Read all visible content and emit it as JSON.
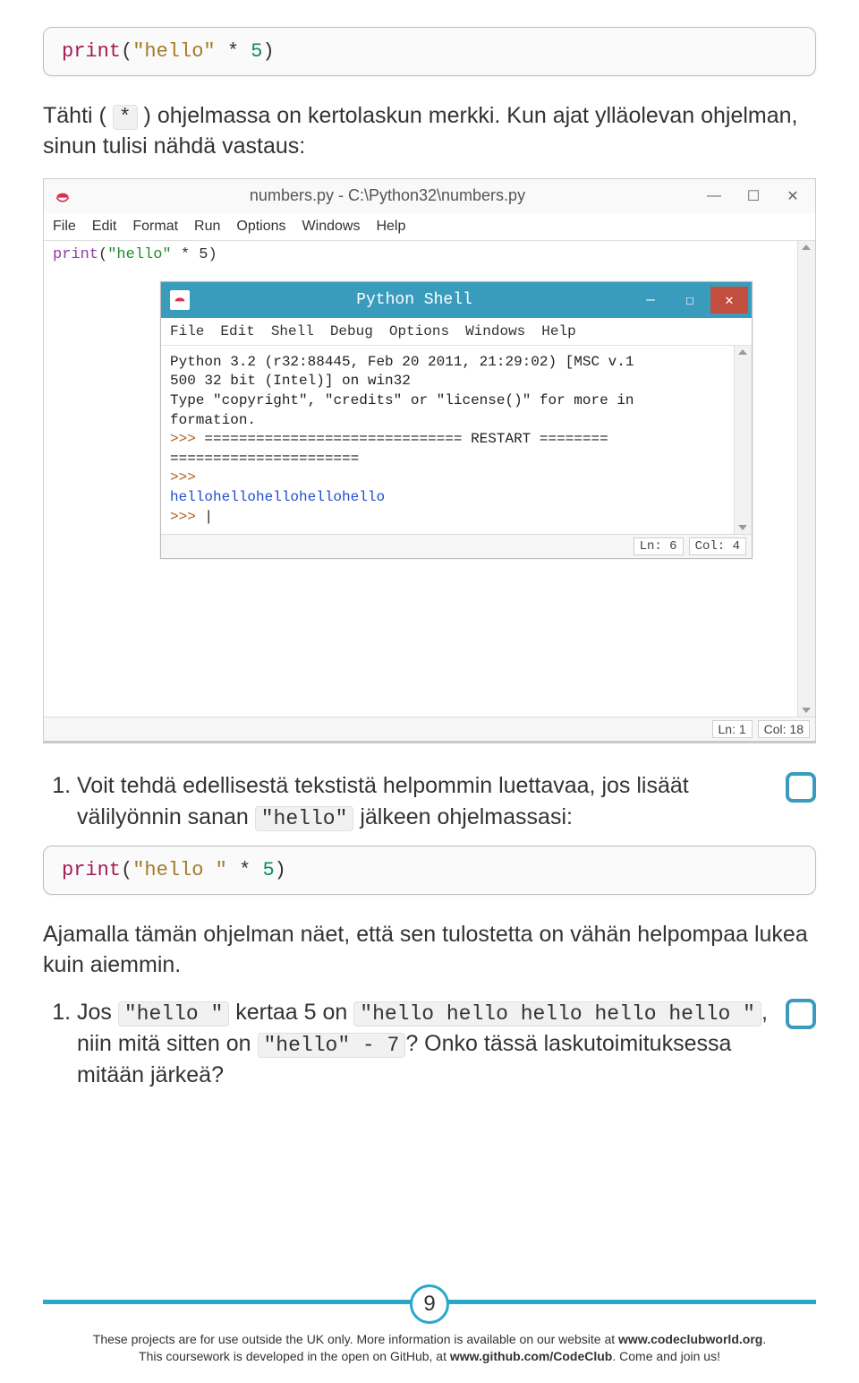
{
  "codeblock1": {
    "print": "print",
    "open": "(",
    "str": "\"hello\"",
    "sp": " * ",
    "num": "5",
    "close": ")"
  },
  "para1": {
    "text_a": "Tähti ( ",
    "inline": "*",
    "text_b": " ) ohjelmassa on kertolaskun merkki. Kun ajat ylläolevan ohjelman, sinun tulisi nähdä vastaus:"
  },
  "ide": {
    "title": "numbers.py - C:\\Python32\\numbers.py",
    "minimize": "—",
    "maximize": "☐",
    "close": "✕",
    "menus": [
      "File",
      "Edit",
      "Format",
      "Run",
      "Options",
      "Windows",
      "Help"
    ],
    "editor_line": {
      "kw": "print",
      "open": "(",
      "str": "\"hello\"",
      "op": " * 5",
      "close": ")"
    },
    "status": {
      "ln": "Ln: 1",
      "col": "Col: 18"
    }
  },
  "shell": {
    "title": "Python Shell",
    "minimize": "—",
    "maximize": "☐",
    "close": "✕",
    "menus": [
      "File",
      "Edit",
      "Shell",
      "Debug",
      "Options",
      "Windows",
      "Help"
    ],
    "line1": "Python 3.2 (r32:88445, Feb 20 2011, 21:29:02) [MSC v.1",
    "line2": "500 32 bit (Intel)] on win32",
    "line3a": "Type ",
    "line3b": "\"copyright\"",
    "line3c": ", ",
    "line3d": "\"credits\"",
    "line3e": " or ",
    "line3f": "\"license()\"",
    "line3g": " for more in",
    "line4": "formation.",
    "prompt": ">>> ",
    "restart_eq1": "============================== ",
    "restart_word": "RESTART",
    "restart_eq2": " ========",
    "eq_cont": "======================",
    "output": "hellohellohellohellohello",
    "cursor": "|",
    "status": {
      "ln": "Ln: 6",
      "col": "Col: 4"
    }
  },
  "step1": {
    "text_a": "Voit tehdä edellisestä tekstistä helpommin luettavaa, jos lisäät välilyönnin sanan ",
    "inline": "\"hello\"",
    "text_b": " jälkeen ohjelmassasi:"
  },
  "codeblock2": {
    "print": "print",
    "open": "(",
    "str": "\"hello \"",
    "sp": " * ",
    "num": "5",
    "close": ")"
  },
  "para2": "Ajamalla tämän ohjelman näet, että sen tulostetta on vähän helpompaa lukea kuin aiemmin.",
  "step2": {
    "text_a": "Jos ",
    "inline1": "\"hello \"",
    "text_b": " kertaa 5 on ",
    "inline2": "\"hello hello hello hello hello \"",
    "text_c": ", niin mitä sitten on ",
    "inline3": "\"hello\" - 7",
    "text_d": "? Onko tässä laskutoimituksessa mitään järkeä?"
  },
  "page_number": "9",
  "footer": {
    "line1a": "These projects are for use outside the UK only. More information is available on our website at ",
    "line1b": "www.codeclubworld.org",
    "line1c": ".",
    "line2a": "This coursework is developed in the open on GitHub, at ",
    "line2b": "www.github.com/CodeClub",
    "line2c": ". Come and join us!"
  }
}
